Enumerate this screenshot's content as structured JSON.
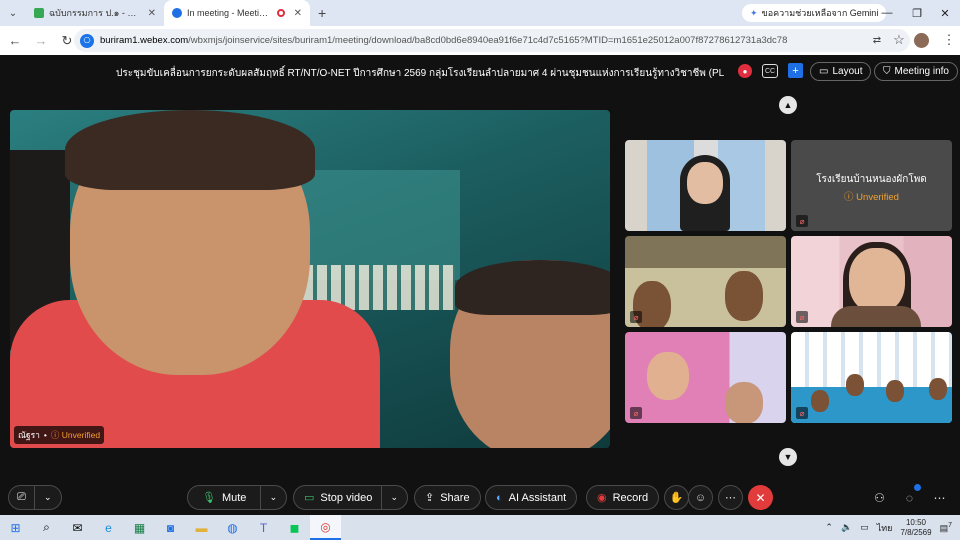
{
  "browser": {
    "tabs": [
      {
        "title": "ฉบับกรรมการ ป.๑ - ป.๒ - Google",
        "favicon_color": "#34a853",
        "active": false
      },
      {
        "title": "In meeting - Meeting - Webex",
        "favicon_color": "#1f6fe5",
        "active": true
      }
    ],
    "gemini_label": "ขอความช่วยเหลือจาก Gemini",
    "url_host": "buriram1.webex.com",
    "url_path": "/wbxmjs/joinservice/sites/buriram1/meeting/download/ba8cd0bd6e8940ea91f6e71c4d7c5165?MTID=m1651e25012a007f87278612731a3dc78"
  },
  "meeting": {
    "title": "ประชุมขับเคลื่อนการยกระดับผลสัมฤทธิ์ RT/NT/O-NET ปีการศึกษา 2569 กลุ่มโรงเรียนลำปลายมาศ 4 ผ่านชุมชนแห่งการเรียนรู้ทางวิชาชีพ (PL",
    "layout_label": "Layout",
    "meeting_info_label": "Meeting info",
    "main_speaker": {
      "name": "ณัฐรา",
      "status": "Unverified"
    },
    "tiles": [
      {
        "type": "video"
      },
      {
        "type": "name",
        "name": "โรงเรียนบ้านหนองผักโพด",
        "status": "Unverified"
      },
      {
        "type": "video"
      },
      {
        "type": "video"
      },
      {
        "type": "video"
      },
      {
        "type": "video"
      }
    ]
  },
  "toolbar": {
    "mute_label": "Mute",
    "stop_video_label": "Stop video",
    "share_label": "Share",
    "ai_label": "AI Assistant",
    "record_label": "Record"
  },
  "taskbar": {
    "time": "10:50",
    "date": "7/8/2569",
    "lang": "ไทย",
    "notif_count": "7"
  },
  "colors": {
    "accent": "#1f6fe5",
    "leave": "#e23b3b",
    "unverified": "#f0a030"
  }
}
